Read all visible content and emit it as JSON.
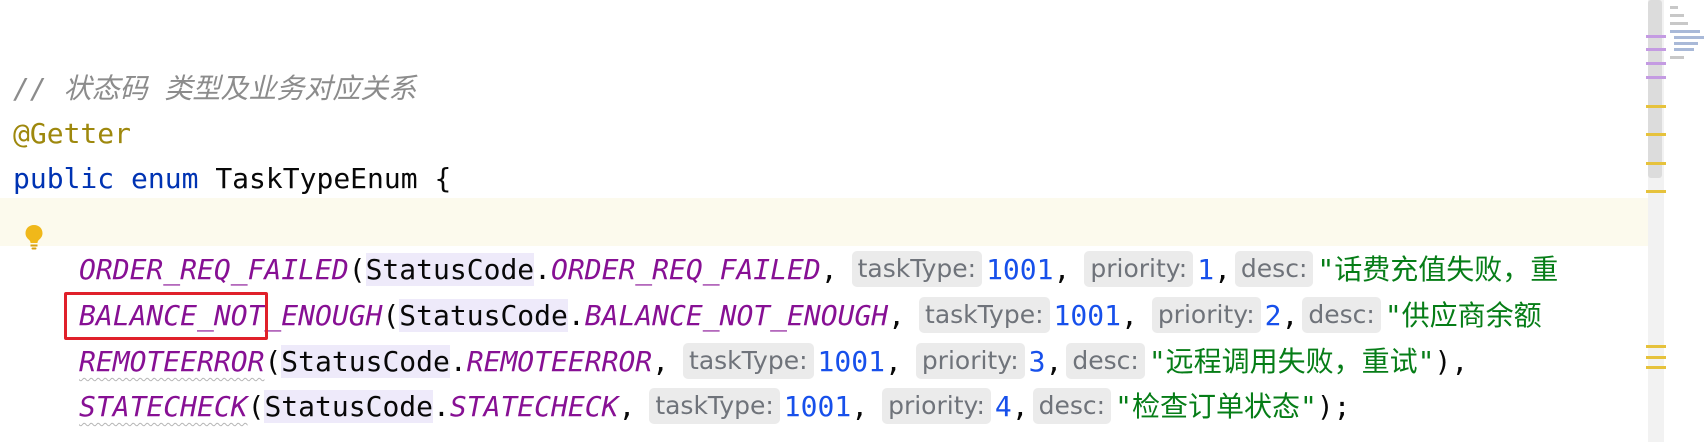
{
  "code": {
    "comment": "// 状态码 类型及业务对应关系",
    "annotation": "@Getter",
    "kw_public": "public",
    "kw_enum": "enum",
    "class_name": "TaskTypeEnum",
    "open_brace": " {",
    "rows": [
      {
        "name": "ORDER_REQ_FAILED",
        "status_class": "StatusCode",
        "status_const": "ORDER_REQ_FAILED",
        "task_type_hint": "taskType:",
        "task_type": "1001",
        "priority_hint": "priority:",
        "priority": "1",
        "desc_hint": "desc:",
        "desc": "\"话费充值失败，重",
        "tail": ""
      },
      {
        "name": "BALANCE_NOT_ENOUGH",
        "status_class": "StatusCode",
        "status_const": "BALANCE_NOT_ENOUGH",
        "task_type_hint": "taskType:",
        "task_type": "1001",
        "priority_hint": "priority:",
        "priority": "2",
        "desc_hint": "desc:",
        "desc": "\"供应商余额",
        "tail": ""
      },
      {
        "name": "REMOTEERROR",
        "status_class": "StatusCode",
        "status_const": "REMOTEERROR",
        "task_type_hint": "taskType:",
        "task_type": "1001",
        "priority_hint": "priority:",
        "priority": "3",
        "desc_hint": "desc:",
        "desc": "\"远程调用失败，重试\"",
        "tail": "),"
      },
      {
        "name": "STATECHECK",
        "status_class": "StatusCode",
        "status_const": "STATECHECK",
        "task_type_hint": "taskType:",
        "task_type": "1001",
        "priority_hint": "priority:",
        "priority": "4",
        "desc_hint": "desc:",
        "desc": "\"检查订单状态\"",
        "tail": ");"
      }
    ]
  },
  "colors": {
    "comment": "#8c8c8c",
    "annotation": "#9e880d",
    "keyword": "#0033b3",
    "enum_constant": "#871094",
    "number": "#1750eb",
    "string": "#067d17",
    "highlight_box": "#e0202a"
  },
  "icons": {
    "gutter": "lightbulb-icon"
  }
}
